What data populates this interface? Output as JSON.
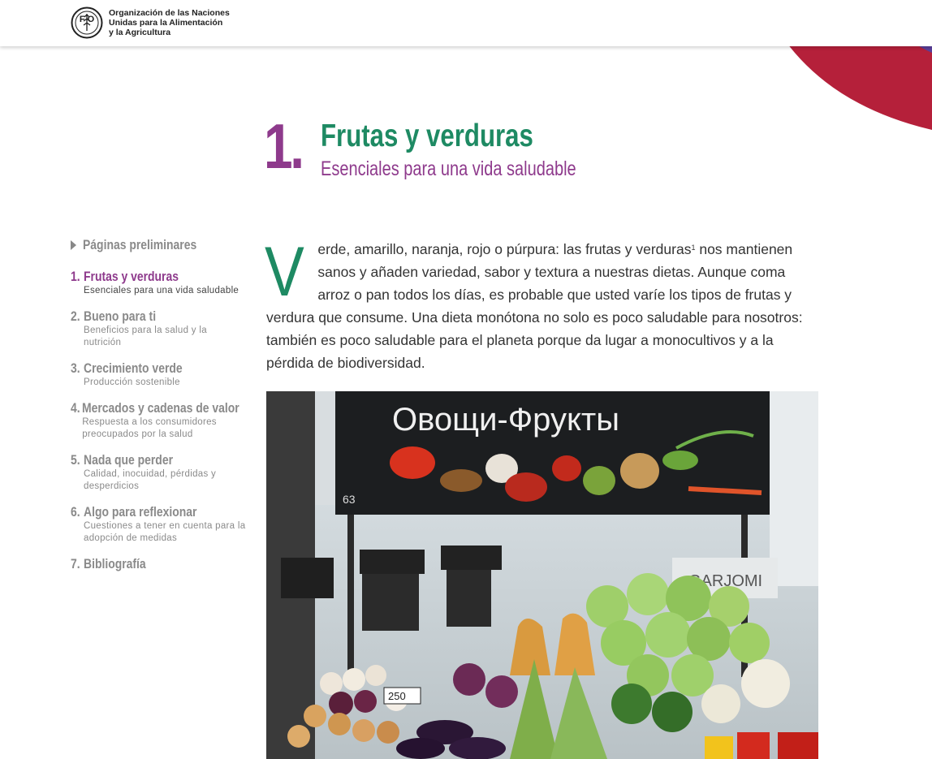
{
  "header": {
    "org_line1": "Organización de las Naciones",
    "org_line2": "Unidas para la Alimentación",
    "org_line3": "y la Agricultura",
    "logo_letters": "F    O"
  },
  "chapter": {
    "number": "1.",
    "title": "Frutas y verduras",
    "subtitle": "Esenciales para una vida saludable"
  },
  "toc": {
    "preliminary": "Páginas preliminares",
    "items": [
      {
        "num": "1.",
        "title": "Frutas y verduras",
        "desc": "Esenciales para una vida saludable",
        "active": true
      },
      {
        "num": "2.",
        "title": "Bueno para ti",
        "desc": "Beneficios para la salud y la nutrición",
        "active": false
      },
      {
        "num": "3.",
        "title": "Crecimiento verde",
        "desc": "Producción sostenible",
        "active": false
      },
      {
        "num": "4.",
        "title": "Mercados y cadenas de valor",
        "desc": "Respuesta a los consumidores preocupados por la salud",
        "active": false
      },
      {
        "num": "5.",
        "title": "Nada que perder",
        "desc": "Calidad, inocuidad, pérdidas y desperdicios",
        "active": false
      },
      {
        "num": "6.",
        "title": "Algo para reflexionar",
        "desc": "Cuestiones a tener en cuenta para la adopción de medidas",
        "active": false
      },
      {
        "num": "7.",
        "title": "Bibliografía",
        "desc": "",
        "active": false
      }
    ]
  },
  "intro": {
    "dropcap": "V",
    "text_before_sup": "erde, amarillo, naranja, rojo o púrpura: las frutas y verduras",
    "sup": "1",
    "text_after_sup": " nos mantienen sanos y añaden variedad, sabor y textura a nuestras dietas. Aunque coma arroz o pan todos los días, es probable que usted varíe los tipos de frutas y verdura que consume. Una dieta monótona no solo es poco saludable para nosotros: también es poco saludable para el planeta porque da lugar a monocultivos y a la pérdida de biodiversidad."
  },
  "photo": {
    "sign_text": "Овощи-Фрукты",
    "stall_number": "63",
    "price_tag": "250",
    "banner_text": "GARJOMI"
  },
  "colors": {
    "green": "#1e8a63",
    "purple": "#8e3a8c",
    "grey": "#8a8a8a",
    "deco_red": "#b5203a"
  }
}
